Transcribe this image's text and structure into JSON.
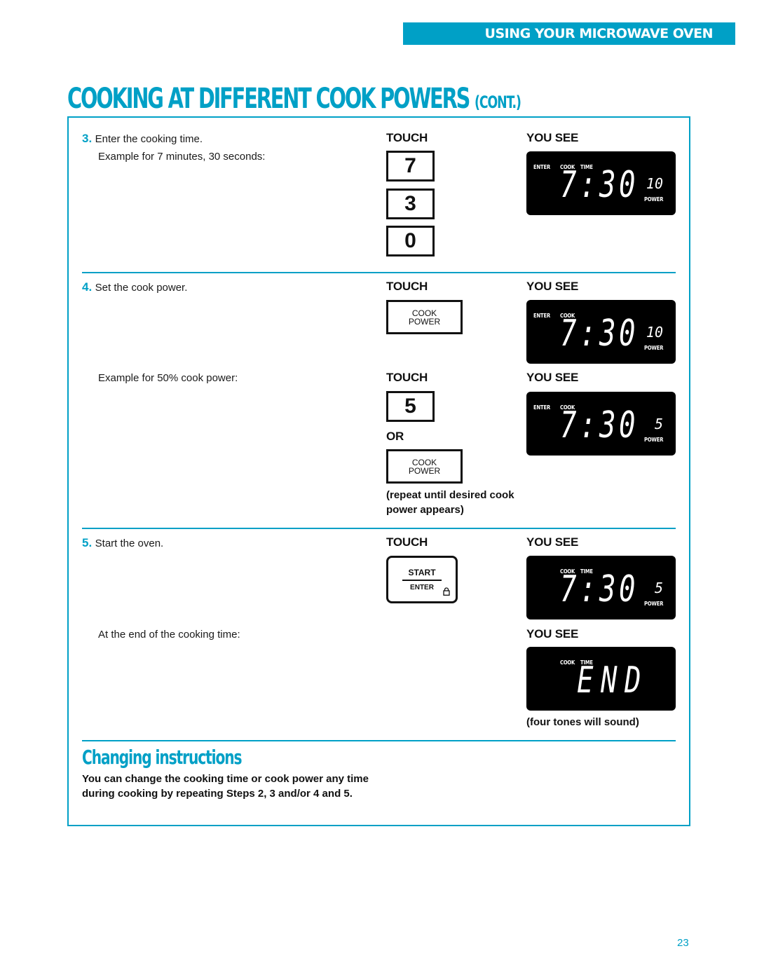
{
  "header": {
    "section_label": "USING YOUR MICROWAVE OVEN",
    "page_title_main": "COOKING AT DIFFERENT COOK POWERS",
    "page_title_suffix": "(CONT.)"
  },
  "colors": {
    "accent": "#00a0c6",
    "display_bg": "#000000",
    "text": "#1a1a1a"
  },
  "columns": {
    "touch": "TOUCH",
    "you_see": "YOU SEE",
    "or": "OR"
  },
  "steps": [
    {
      "number": "3.",
      "text": "Enter the cooking time.",
      "example": "Example for 7 minutes, 30 seconds:",
      "keys": [
        "7",
        "3",
        "0"
      ],
      "display": {
        "labels": [
          "ENTER",
          "COOK",
          "TIME"
        ],
        "time": "7:30",
        "power_value": "10",
        "power_label": "POWER"
      }
    },
    {
      "number": "4.",
      "text": "Set the cook power.",
      "key": {
        "line1": "COOK",
        "line2": "POWER"
      },
      "display": {
        "labels": [
          "ENTER",
          "COOK"
        ],
        "time": "7:30",
        "power_value": "10",
        "power_label": "POWER"
      },
      "example": "Example for 50% cook power:",
      "example_key": "5",
      "alt_key": {
        "line1": "COOK",
        "line2": "POWER"
      },
      "note": "(repeat until desired cook power appears)",
      "example_display": {
        "labels": [
          "ENTER",
          "COOK"
        ],
        "time": "7:30",
        "power_value": "5",
        "power_label": "POWER"
      }
    },
    {
      "number": "5.",
      "text": "Start the oven.",
      "key": {
        "line1": "START",
        "line2": "ENTER",
        "icon": "lock-icon"
      },
      "display": {
        "labels": [
          "COOK",
          "TIME"
        ],
        "time": "7:30",
        "power_value": "5",
        "power_label": "POWER"
      },
      "end_text": "At the end of the cooking time:",
      "end_display": {
        "labels": [
          "COOK",
          "TIME"
        ],
        "text": "END"
      },
      "end_note": "(four tones will sound)"
    }
  ],
  "changing": {
    "title": "Changing instructions",
    "text": "You can change the cooking time or cook power any time during cooking by repeating Steps 2, 3 and/or 4 and 5."
  },
  "page_number": "23"
}
